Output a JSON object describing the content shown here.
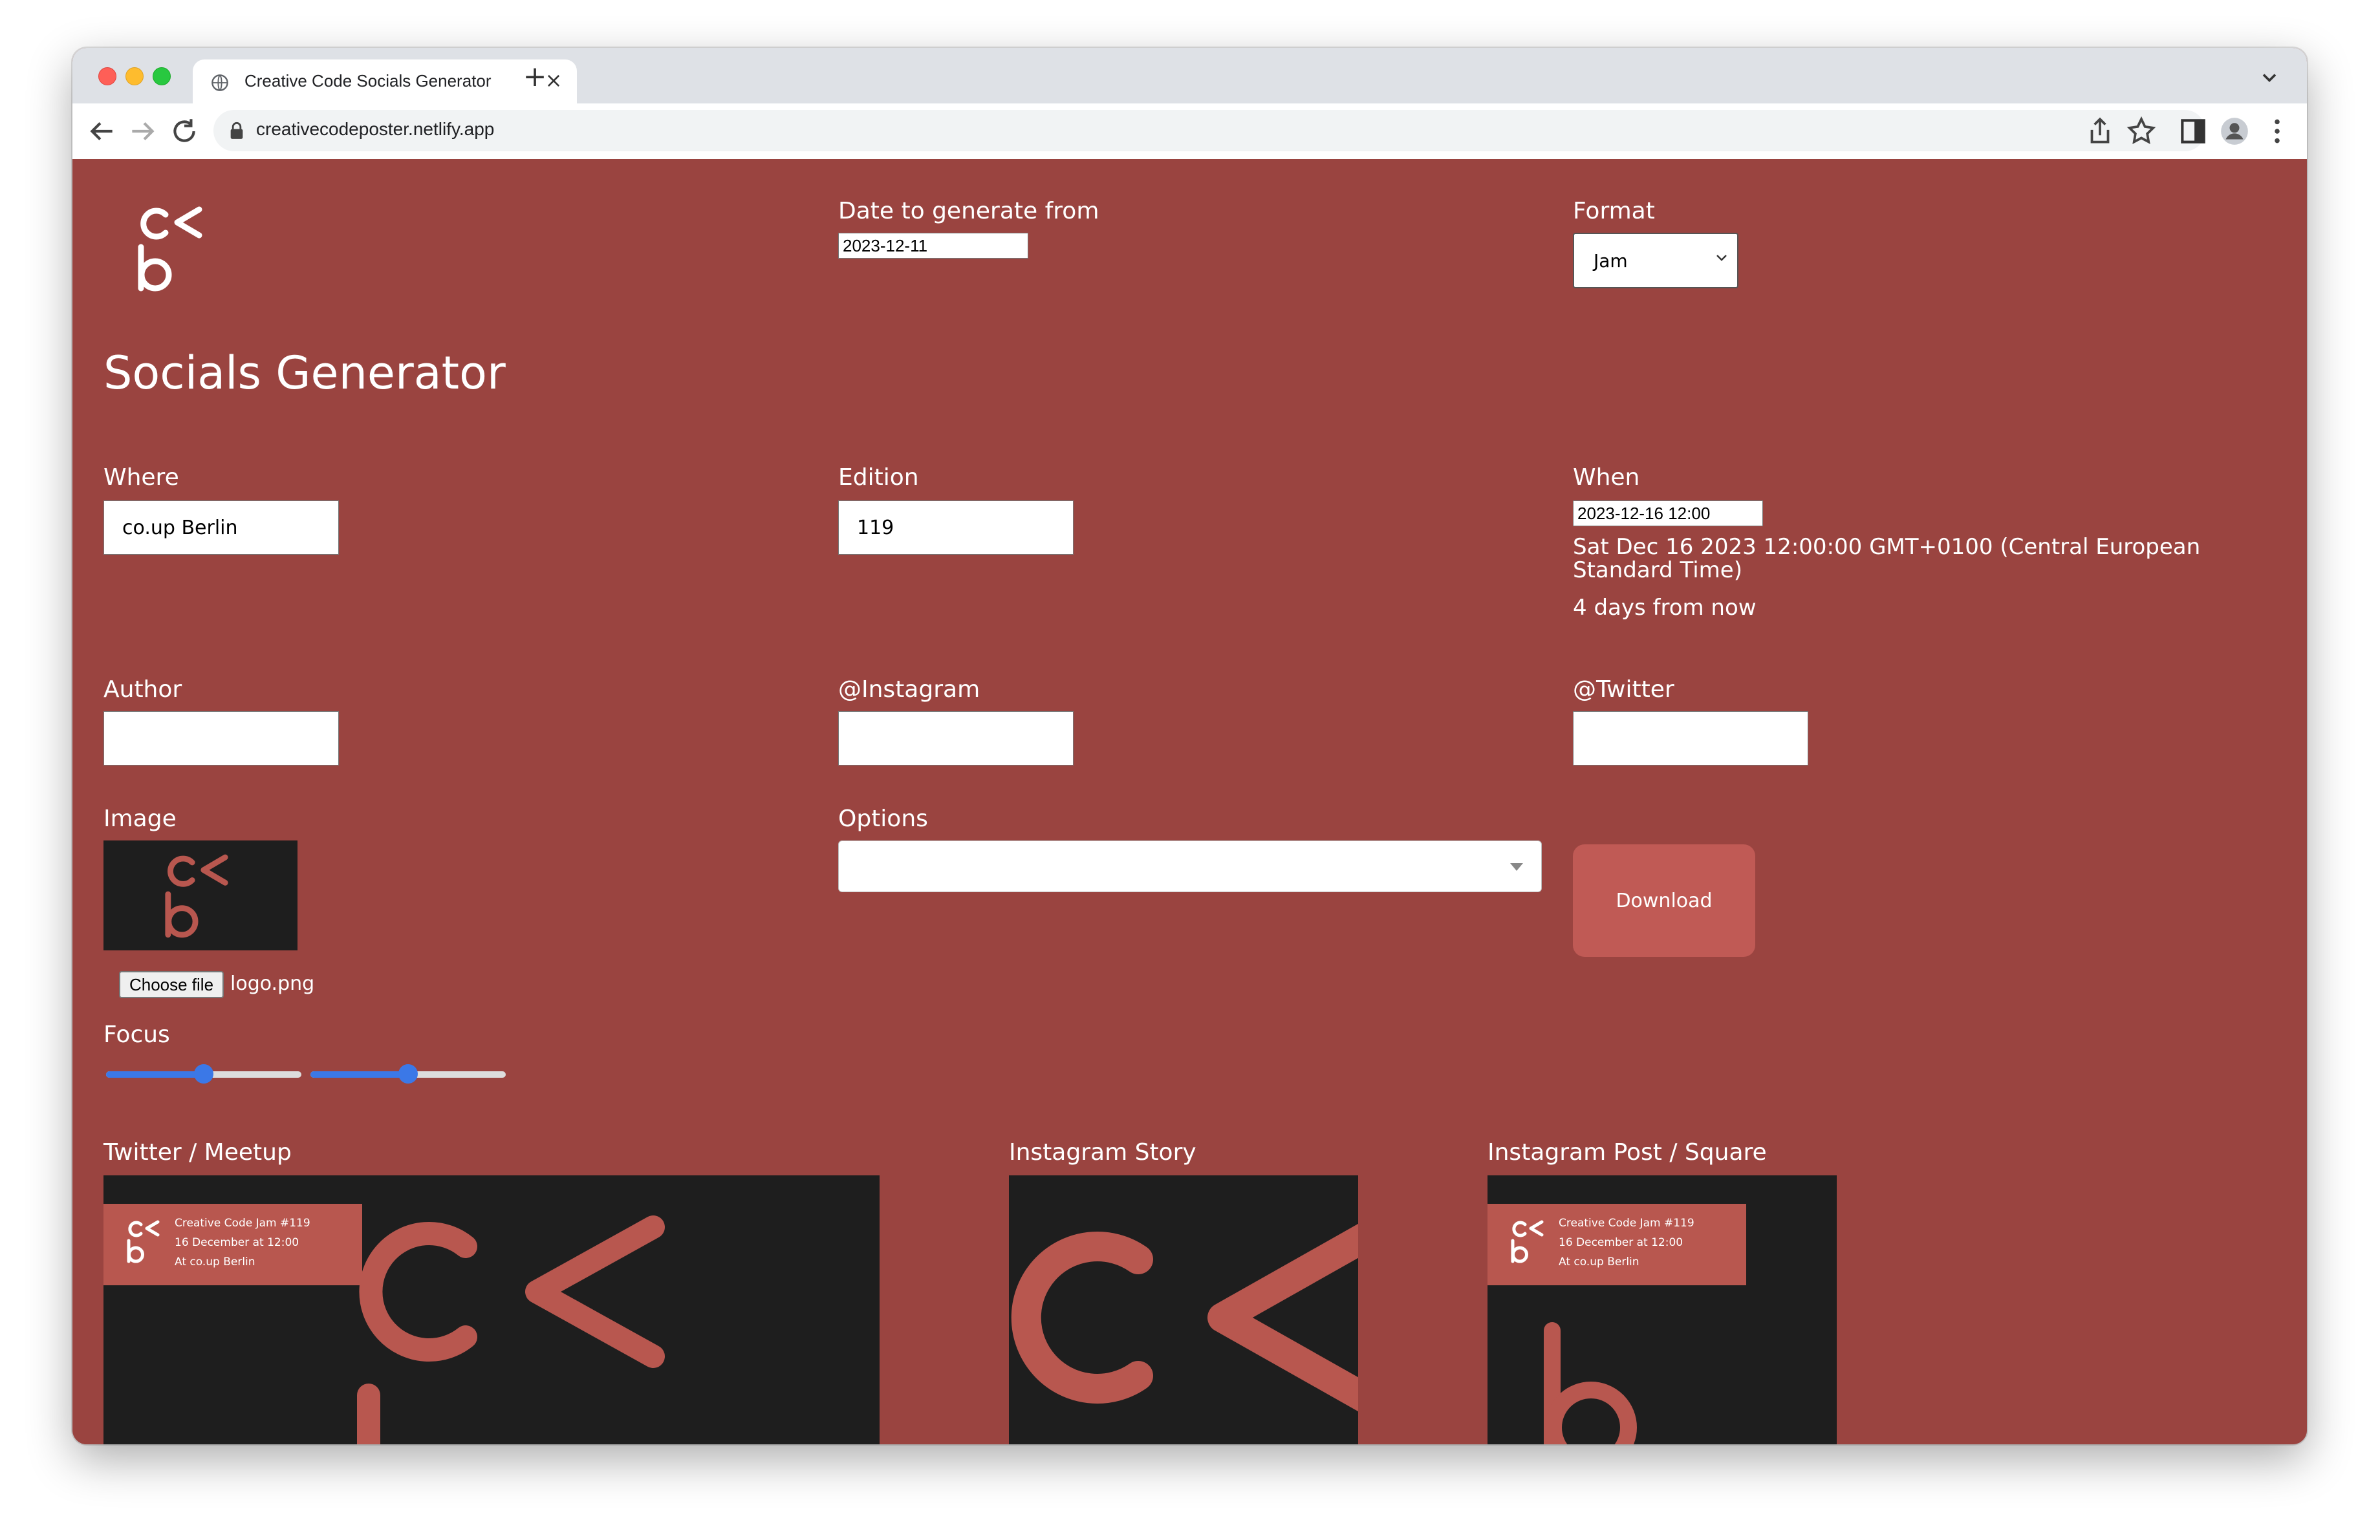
{
  "browser": {
    "tab_title": "Creative Code Socials Generator",
    "url": "creativecodeposter.netlify.app"
  },
  "header": {
    "logo_text": "c< b",
    "title": "Socials Generator"
  },
  "form": {
    "date_label": "Date to generate from",
    "date_value": "2023-12-11",
    "format_label": "Format",
    "format_value": "Jam",
    "where_label": "Where",
    "where_value": "co.up Berlin",
    "edition_label": "Edition",
    "edition_value": "119",
    "when_label": "When",
    "when_value": "2023-12-16 12:00",
    "when_full": "Sat Dec 16 2023 12:00:00 GMT+0100 (Central European Standard Time)",
    "when_relative": "4 days from now",
    "author_label": "Author",
    "author_value": "",
    "instagram_label": "@Instagram",
    "instagram_value": "",
    "twitter_label": "@Twitter",
    "twitter_value": "",
    "image_label": "Image",
    "choose_file_label": "Choose file",
    "file_name": "logo.png",
    "options_label": "Options",
    "download_label": "Download",
    "focus_label": "Focus",
    "focus_x": 0.5,
    "focus_y": 0.5
  },
  "previews": {
    "twitter_label": "Twitter / Meetup",
    "story_label": "Instagram Story",
    "post_label": "Instagram Post / Square",
    "banner_line1": "Creative Code Jam #119",
    "banner_line2": "16 December at 12:00",
    "banner_line3": "At co.up Berlin"
  },
  "colors": {
    "page_bg": "#9a4440",
    "accent": "#c05a55",
    "slider": "#3b78e7"
  }
}
